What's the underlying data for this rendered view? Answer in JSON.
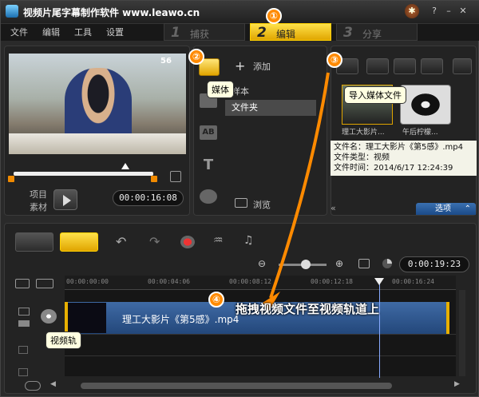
{
  "window": {
    "title": "视频片尾字幕制作软件 www.leawo.cn"
  },
  "menu": {
    "items": [
      "文件",
      "编辑",
      "工具",
      "设置"
    ]
  },
  "steps": [
    {
      "num": "1",
      "label": "捕获",
      "active": false
    },
    {
      "num": "2",
      "label": "编辑",
      "active": true
    },
    {
      "num": "3",
      "label": "分享",
      "active": false
    }
  ],
  "preview": {
    "watermark": "56",
    "project_label": "项目",
    "clip_label": "素材",
    "timecode": "00:00:16:08",
    "scrub_position": 0.8
  },
  "library": {
    "add_label": "添加",
    "items": [
      "样本",
      "文件夹"
    ],
    "selected": "文件夹",
    "browse_label": "浏览",
    "media_tooltip": "媒体"
  },
  "media": {
    "import_tooltip": "导入媒体文件",
    "thumbs": [
      "理工大影片...",
      "午后柠檬..."
    ],
    "info": {
      "name_line": "文件名：理工大影片《第5感》.mp4",
      "type_line": "文件类型：视频",
      "time_line": "文件时间：2014/6/17 12:24:39"
    },
    "options_label": "选项"
  },
  "timeline": {
    "timecode": "0:00:19:23",
    "ruler": [
      "00:00:00:00",
      "00:00:04:06",
      "00:00:08:12",
      "00:00:12:18",
      "00:00:16:24"
    ],
    "clip_name": "理工大影片《第5感》.mp4",
    "video_track_tooltip": "视频轨"
  },
  "annotations": {
    "badges": [
      "①",
      "②",
      "③",
      "④"
    ],
    "callout": "拖拽视频文件至视频轨道上"
  },
  "colors": {
    "accent": "#ffd000",
    "badge": "#ff8a00",
    "arrow": "#ff8a00",
    "clip": "#3f6aa5"
  }
}
